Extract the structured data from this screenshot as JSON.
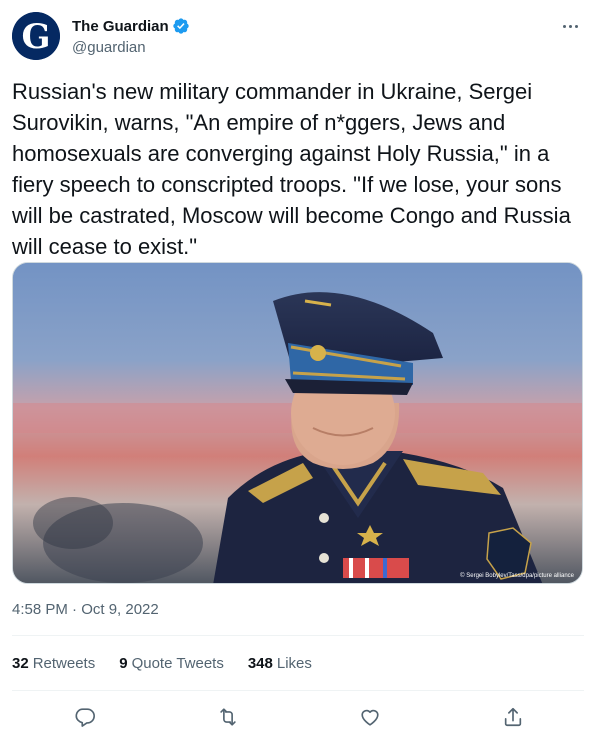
{
  "account": {
    "display_name": "The Guardian",
    "handle": "@guardian",
    "avatar_letter": "G",
    "verified": true
  },
  "tweet": {
    "text": "Russian's new military commander in Ukraine, Sergei Surovikin, warns, \"An empire of n*ggers, Jews and homosexuals are converging against Holy Russia,\" in a fiery speech to conscripted troops. \"If we lose, your sons will be castrated, Moscow will become Congo and Russia will cease to exist.\"",
    "image_credit": "© Sergei Bobylev/Tass/dpa/picture alliance",
    "timestamp": "4:58 PM · Oct 9, 2022"
  },
  "stats": {
    "retweets_count": "32",
    "retweets_label": "Retweets",
    "quotes_count": "9",
    "quotes_label": "Quote Tweets",
    "likes_count": "348",
    "likes_label": "Likes"
  },
  "icons": [
    "more-icon",
    "verified-badge-icon",
    "reply-icon",
    "retweet-icon",
    "like-icon",
    "share-icon"
  ],
  "colors": {
    "text": "#0f1419",
    "secondary": "#536471",
    "verified_blue": "#1d9bf0",
    "guardian_navy": "#052962"
  }
}
